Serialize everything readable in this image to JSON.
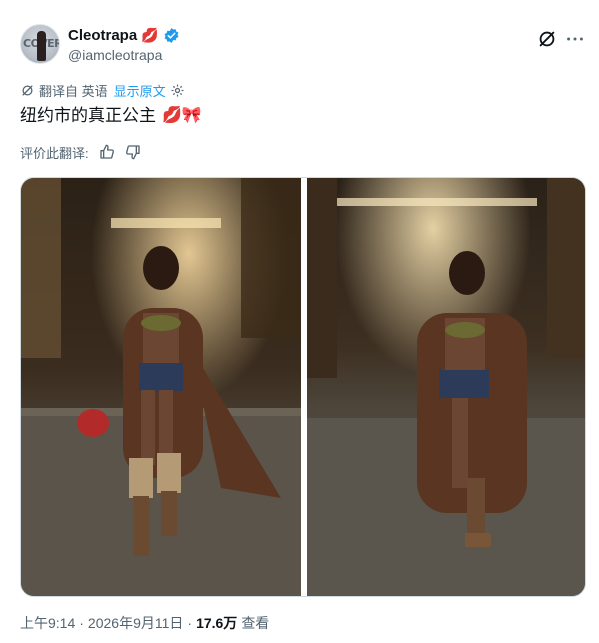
{
  "author": {
    "display_name": "Cleotrapa",
    "name_emoji": "💋",
    "handle": "@iamcleotrapa",
    "avatar_text": "COVER",
    "verified": true,
    "verified_color": "#1d9bf0"
  },
  "translation": {
    "label": "翻译自 英语",
    "show_original": "显示原文"
  },
  "tweet": {
    "text": "纽约市的真正公主",
    "emojis": "💋🎀"
  },
  "rating": {
    "label": "评价此翻译:"
  },
  "media": [
    {
      "alt": "photo-1",
      "icon": "photo"
    },
    {
      "alt": "photo-2",
      "icon": "photo"
    }
  ],
  "meta": {
    "time": "上午9:14",
    "date": "2026年9月11日",
    "separator": "·",
    "views_count": "17.6万",
    "views_label": "查看"
  },
  "colors": {
    "accent": "#1d9bf0",
    "text": "#0f1419",
    "secondary": "#536471"
  },
  "icons": {
    "grok": "grok-icon",
    "more": "more-icon",
    "translate": "translate-icon",
    "settings": "gear-icon",
    "thumb_up": "thumbs-up-icon",
    "thumb_down": "thumbs-down-icon"
  }
}
